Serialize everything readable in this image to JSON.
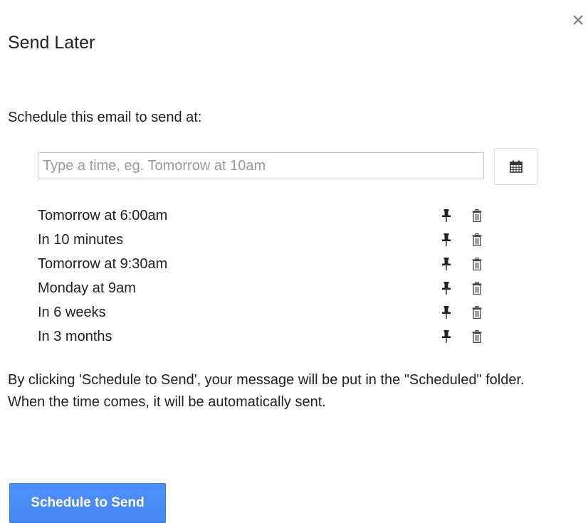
{
  "dialog": {
    "title": "Send Later",
    "close_glyph": "×",
    "close_icon": "close-icon",
    "subtitle": "Schedule this email to send at:",
    "input": {
      "value": "",
      "placeholder": "Type a time, eg. Tomorrow at 10am"
    },
    "calendar_icon": "calendar-icon",
    "presets": [
      {
        "label": "Tomorrow at 6:00am",
        "pin_icon": "pin-icon",
        "delete_icon": "trash-icon"
      },
      {
        "label": "In 10 minutes",
        "pin_icon": "pin-icon",
        "delete_icon": "trash-icon"
      },
      {
        "label": "Tomorrow at 9:30am",
        "pin_icon": "pin-icon",
        "delete_icon": "trash-icon"
      },
      {
        "label": "Monday at 9am",
        "pin_icon": "pin-icon",
        "delete_icon": "trash-icon"
      },
      {
        "label": "In 6 weeks",
        "pin_icon": "pin-icon",
        "delete_icon": "trash-icon"
      },
      {
        "label": "In 3 months",
        "pin_icon": "pin-icon",
        "delete_icon": "trash-icon"
      }
    ],
    "info_text": "By clicking 'Schedule to Send', your message will be put in the \"Scheduled\" folder. When the time comes, it will be automatically sent.",
    "schedule_button": "Schedule to Send"
  },
  "colors": {
    "button_blue": "#4d90fe",
    "text": "#222222",
    "placeholder": "#9a9a9a",
    "close": "#777777"
  }
}
